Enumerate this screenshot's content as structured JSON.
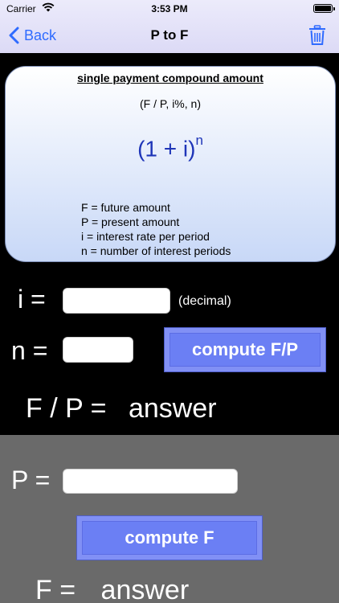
{
  "status": {
    "carrier": "Carrier",
    "time": "3:53 PM"
  },
  "nav": {
    "back_label": "Back",
    "title": "P to F"
  },
  "card": {
    "title": "single payment compound amount",
    "notation": "(F / P, i%, n)",
    "formula_base": "(1 + i)",
    "formula_exp": "n",
    "definitions": [
      "F = future amount",
      "P = present amount",
      "i = interest rate per period",
      "n = number of interest periods"
    ]
  },
  "inputs": {
    "i_label": "i =",
    "i_value": "",
    "i_unit": "(decimal)",
    "n_label": "n =",
    "n_value": "",
    "compute_fp_label": "compute F/P"
  },
  "result": {
    "fp_label": "F / P =",
    "fp_value": "answer"
  },
  "lower": {
    "p_label": "P =",
    "p_value": "",
    "compute_f_label": "compute F",
    "f_label": "F =",
    "f_value": "answer"
  },
  "colors": {
    "accent": "#2f6bff",
    "formula": "#1e35b8",
    "button": "#6b7ff4",
    "lower_bg": "#6a6a6a"
  },
  "icons": {
    "back": "chevron-left-icon",
    "trash": "trash-icon",
    "wifi": "wifi-icon",
    "battery": "battery-icon"
  }
}
